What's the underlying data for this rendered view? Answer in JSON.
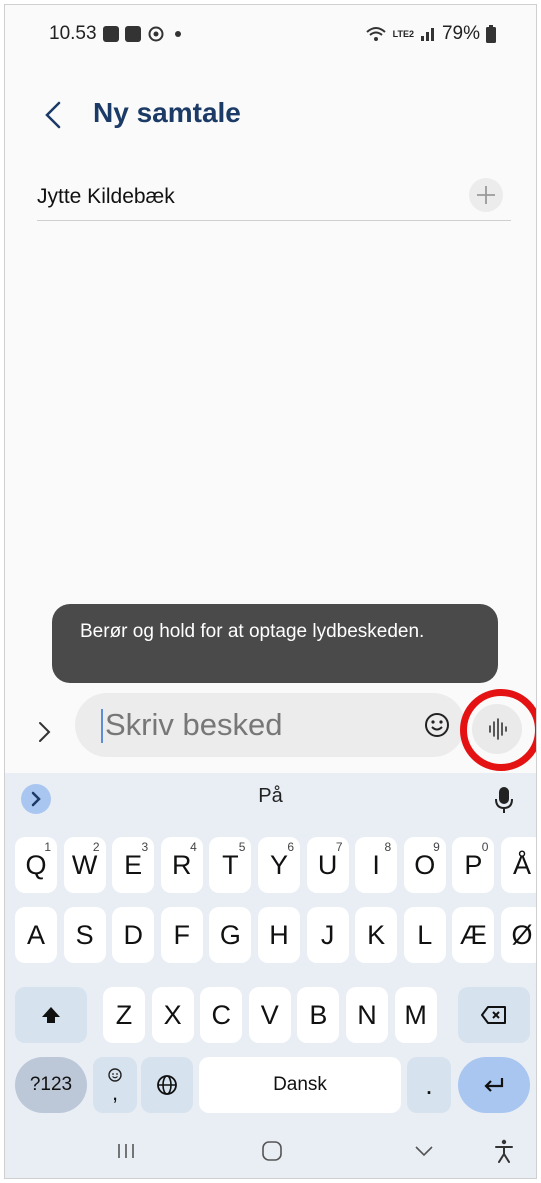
{
  "status": {
    "time": "10.53",
    "lte_label": "LTE2",
    "battery": "79%"
  },
  "header": {
    "title": "Ny samtale"
  },
  "recipient": {
    "name": "Jytte Kildebæk"
  },
  "tooltip": {
    "text": "Berør og hold for at optage lydbeskeden."
  },
  "compose": {
    "placeholder": "Skriv besked"
  },
  "keyboard": {
    "suggestion": "På",
    "row1": [
      {
        "label": "Q",
        "num": "1"
      },
      {
        "label": "W",
        "num": "2"
      },
      {
        "label": "E",
        "num": "3"
      },
      {
        "label": "R",
        "num": "4"
      },
      {
        "label": "T",
        "num": "5"
      },
      {
        "label": "Y",
        "num": "6"
      },
      {
        "label": "U",
        "num": "7"
      },
      {
        "label": "I",
        "num": "8"
      },
      {
        "label": "O",
        "num": "9"
      },
      {
        "label": "P",
        "num": "0"
      },
      {
        "label": "Å",
        "num": ""
      }
    ],
    "row2": [
      "A",
      "S",
      "D",
      "F",
      "G",
      "H",
      "J",
      "K",
      "L",
      "Æ",
      "Ø"
    ],
    "row3": [
      "Z",
      "X",
      "C",
      "V",
      "B",
      "N",
      "M"
    ],
    "symbols_label": "?123",
    "comma_label": ",",
    "space_label": "Dansk",
    "period_label": "."
  },
  "colors": {
    "accent": "#1b3a66",
    "highlight_ring": "#e41212",
    "keyboard_bg": "#e9eef4",
    "enter_key": "#a9c6f1"
  }
}
